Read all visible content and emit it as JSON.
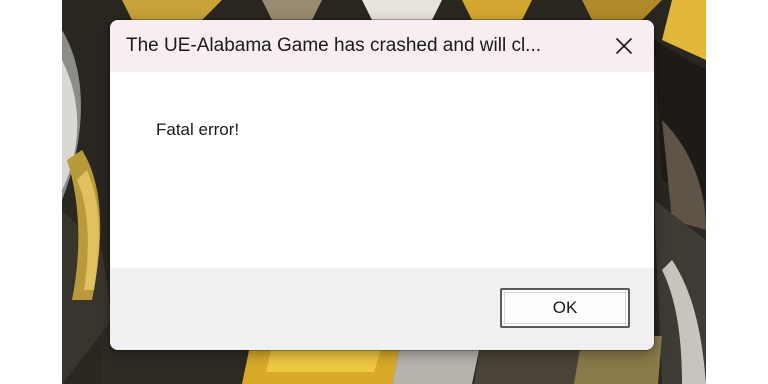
{
  "dialog": {
    "title": "The UE-Alabama Game has crashed and will cl...",
    "message": "Fatal error!",
    "ok_label": "OK",
    "close_icon": "close-icon"
  },
  "colors": {
    "titlebar_bg": "#f8eef1",
    "footer_bg": "#f0f0f0",
    "wallpaper_dark": "#2b2620",
    "wallpaper_gold": "#d8ac2c"
  }
}
